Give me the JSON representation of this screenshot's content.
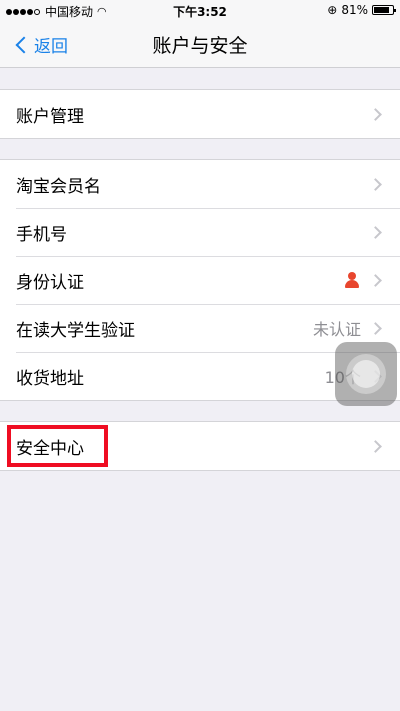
{
  "status_bar": {
    "carrier": "中国移动",
    "time": "下午3:52",
    "battery": "81%",
    "battery_level": 0.81
  },
  "nav": {
    "back_label": "返回",
    "title": "账户与安全"
  },
  "group1": {
    "items": [
      {
        "label": "账户管理"
      }
    ]
  },
  "group2": {
    "items": [
      {
        "label": "淘宝会员名"
      },
      {
        "label": "手机号"
      },
      {
        "label": "身份认证"
      },
      {
        "label": "在读大学生验证",
        "value": "未认证"
      },
      {
        "label": "收货地址",
        "value": "10个"
      }
    ]
  },
  "group3": {
    "items": [
      {
        "label": "安全中心"
      }
    ]
  },
  "colors": {
    "accent": "#1a82e8",
    "highlight": "#ef0d22",
    "id_icon": "#e8462e"
  }
}
